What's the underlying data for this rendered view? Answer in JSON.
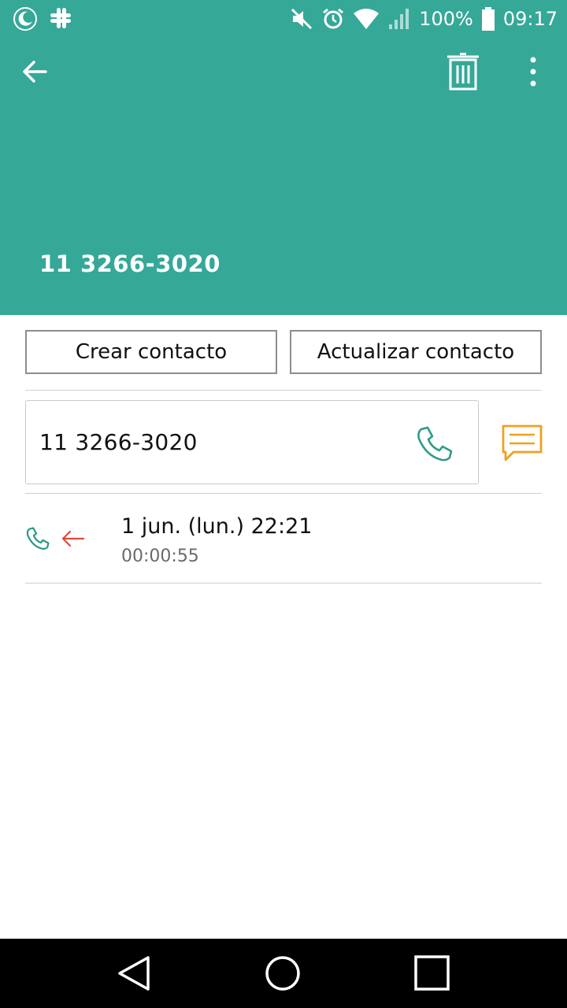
{
  "status_bar": {
    "battery": "100%",
    "time": "09:17",
    "icons": [
      "moon-icon",
      "slack-icon",
      "mute-icon",
      "alarm-icon",
      "wifi-icon",
      "signal-icon",
      "battery-icon"
    ]
  },
  "app_bar": {
    "back_icon": "arrow-left-icon",
    "delete_icon": "trash-icon",
    "more_icon": "more-vert-icon"
  },
  "header": {
    "phone_number": "11 3266-3020"
  },
  "actions": {
    "create_contact": "Crear contacto",
    "update_contact": "Actualizar contacto"
  },
  "number_row": {
    "number": "11 3266-3020",
    "call_icon": "phone-icon",
    "message_icon": "message-icon"
  },
  "call_log": [
    {
      "date": "1 jun. (lun.) 22:21",
      "duration": "00:00:55",
      "type_icon": "phone-icon",
      "direction_icon": "incoming-arrow-icon"
    }
  ],
  "colors": {
    "header": "#35a898",
    "accent_green": "#2e9b86",
    "message_orange": "#f0a020",
    "incoming_red": "#e04a3a"
  },
  "nav_bar": {
    "back_icon": "triangle-back-icon",
    "home_icon": "circle-home-icon",
    "recent_icon": "square-recent-icon"
  }
}
